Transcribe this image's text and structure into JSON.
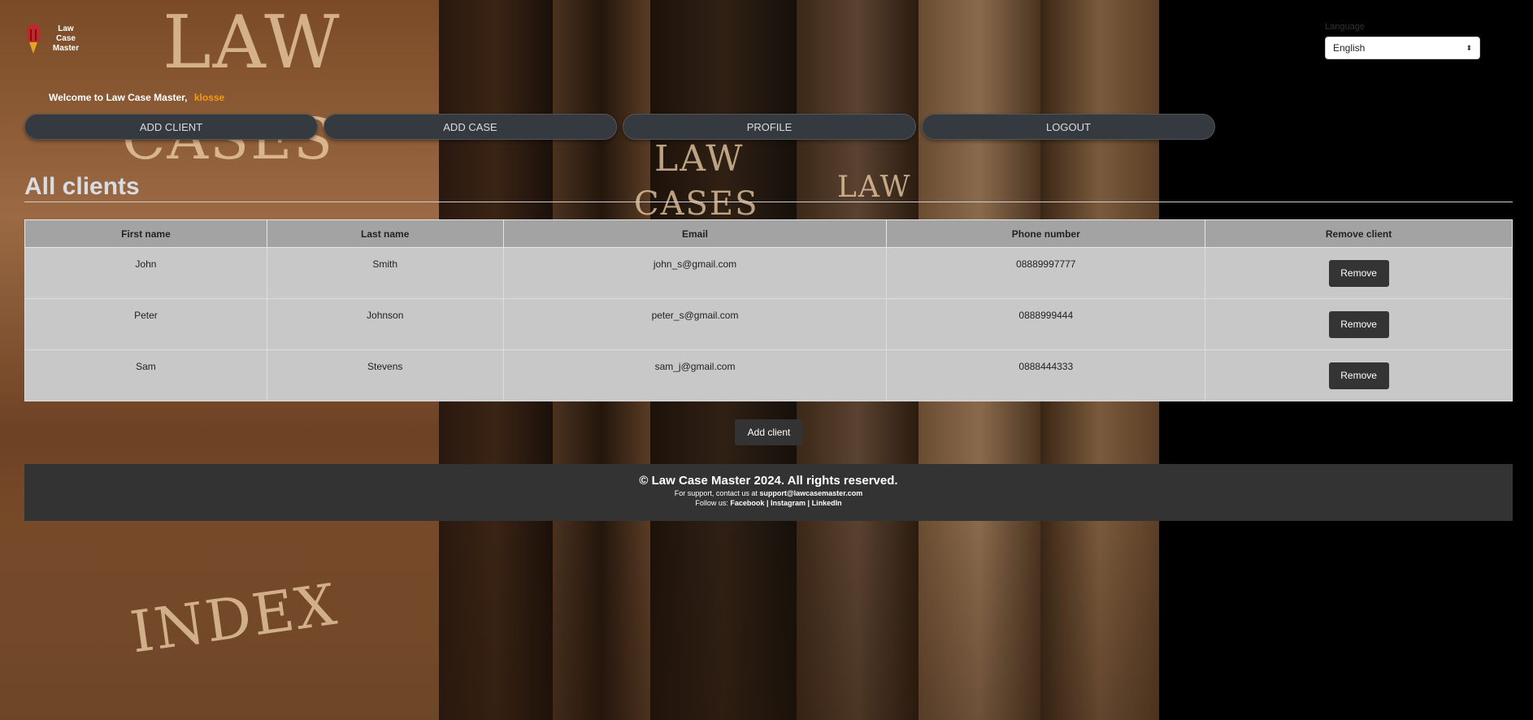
{
  "brand": {
    "logo_text": "Law\nCase\nMaster",
    "accent": "#f39c12",
    "logo_red": "#c0282d",
    "logo_gold": "#e5a51c"
  },
  "language": {
    "label": "Language",
    "selected": "English"
  },
  "welcome": {
    "text": "Welcome to Law Case Master,",
    "username": "klosse"
  },
  "nav": [
    {
      "label": "ADD CLIENT"
    },
    {
      "label": "ADD CASE"
    },
    {
      "label": "PROFILE"
    },
    {
      "label": "LOGOUT"
    }
  ],
  "page": {
    "title": "All clients"
  },
  "table": {
    "headers": [
      "First name",
      "Last name",
      "Email",
      "Phone number",
      "Remove client"
    ],
    "rows": [
      {
        "first": "John",
        "last": "Smith",
        "email": "john_s@gmail.com",
        "phone": "08889997777",
        "action": "Remove"
      },
      {
        "first": "Peter",
        "last": "Johnson",
        "email": "peter_s@gmail.com",
        "phone": "0888999444",
        "action": "Remove"
      },
      {
        "first": "Sam",
        "last": "Stevens",
        "email": "sam_j@gmail.com",
        "phone": "0888444333",
        "action": "Remove"
      }
    ]
  },
  "add_client_label": "Add client",
  "footer": {
    "copyright": "© Law Case Master 2024. All rights reserved.",
    "support_prefix": "For support, contact us at",
    "support_email": "support@lawcasemaster.com",
    "follow_prefix": "Follow us:",
    "social": [
      "Facebook",
      "Instagram",
      "LinkedIn"
    ],
    "separator": "|"
  },
  "background": {
    "spine_texts": [
      "LAW",
      "CASES",
      "LAW",
      "CASES",
      "LAW",
      "CASES",
      "INDEX"
    ]
  }
}
